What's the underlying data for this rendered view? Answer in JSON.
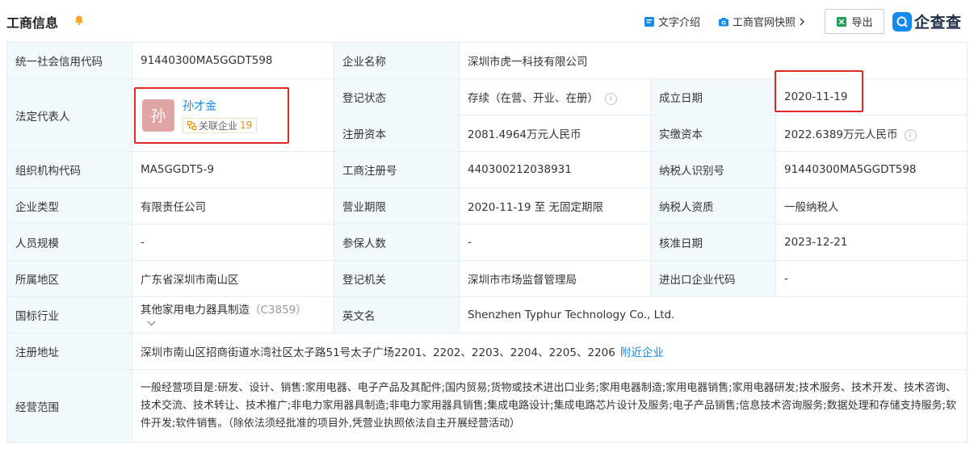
{
  "header": {
    "title": "工商信息",
    "text_intro": "文字介绍",
    "snapshot": "工商官网快照",
    "export": "导出",
    "logo": "企查查"
  },
  "rows": {
    "credit_code_label": "统一社会信用代码",
    "credit_code": "91440300MA5GGDT598",
    "company_name_label": "企业名称",
    "company_name": "深圳市虎一科技有限公司",
    "legal_rep_label": "法定代表人",
    "avatar_char": "孙",
    "legal_rep": "孙才金",
    "related_label": "关联企业",
    "related_count": "19",
    "reg_status_label": "登记状态",
    "reg_status": "存续（在营、开业、在册）",
    "est_date_label": "成立日期",
    "est_date": "2020-11-19",
    "reg_capital_label": "注册资本",
    "reg_capital": "2081.4964万元人民币",
    "paid_capital_label": "实缴资本",
    "paid_capital": "2022.6389万元人民币",
    "org_code_label": "组织机构代码",
    "org_code": "MA5GGDT5-9",
    "biz_reg_no_label": "工商注册号",
    "biz_reg_no": "440300212038931",
    "taxpayer_id_label": "纳税人识别号",
    "taxpayer_id": "91440300MA5GGDT598",
    "company_type_label": "企业类型",
    "company_type": "有限责任公司",
    "biz_term_label": "营业期限",
    "biz_term": "2020-11-19 至 无固定期限",
    "taxpayer_qual_label": "纳税人资质",
    "taxpayer_qual": "一般纳税人",
    "staff_size_label": "人员规模",
    "staff_size": "-",
    "insured_label": "参保人数",
    "insured": "-",
    "approve_date_label": "核准日期",
    "approve_date": "2023-12-21",
    "region_label": "所属地区",
    "region": "广东省深圳市南山区",
    "reg_authority_label": "登记机关",
    "reg_authority": "深圳市市场监督管理局",
    "ie_code_label": "进出口企业代码",
    "ie_code": "-",
    "industry_label": "国标行业",
    "industry": "其他家用电力器具制造",
    "industry_code": "（C3859）",
    "english_name_label": "英文名",
    "english_name": "Shenzhen Typhur Technology Co., Ltd.",
    "address_label": "注册地址",
    "address": "深圳市南山区招商街道水湾社区太子路51号太子广场2201、2202、2203、2204、2205、2206",
    "nearby": "附近企业",
    "scope_label": "经营范围",
    "scope": "一般经营项目是:研发、设计、销售:家用电器、电子产品及其配件;国内贸易;货物或技术进出口业务;家用电器制造;家用电器销售;家用电器研发;技术服务、技术开发、技术咨询、技术交流、技术转让、技术推广;非电力家用器具制造;非电力家用器具销售;集成电路设计;集成电路芯片设计及服务;电子产品销售;信息技术咨询服务;数据处理和存储支持服务;软件开发;软件销售。（除依法须经批准的项目外,凭营业执照依法自主开展经营活动）"
  },
  "colors": {
    "label_bg": "#f2f9fc",
    "border": "#e4eef6",
    "link": "#128bed",
    "highlight_box": "#e02828",
    "avatar_bg": "#e0a4a4"
  }
}
